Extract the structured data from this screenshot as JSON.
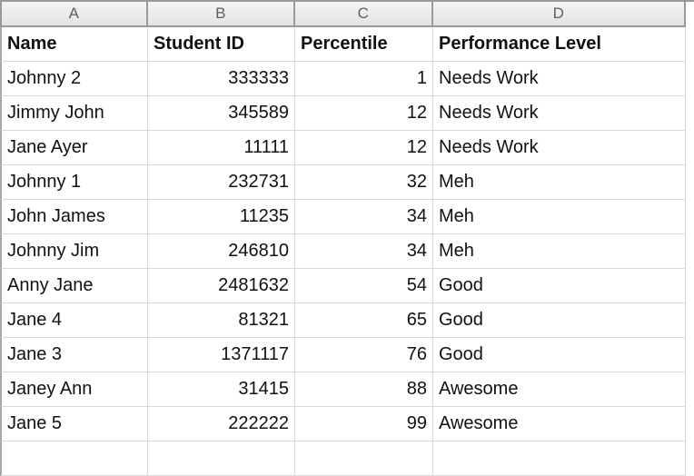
{
  "spreadsheet": {
    "column_letters": [
      "A",
      "B",
      "C",
      "D"
    ],
    "header_row": {
      "name": "Name",
      "student_id": "Student ID",
      "percentile": "Percentile",
      "performance_level": "Performance Level"
    },
    "rows": [
      {
        "name": "Johnny 2",
        "student_id": "333333",
        "percentile": "1",
        "performance_level": "Needs Work"
      },
      {
        "name": "Jimmy John",
        "student_id": "345589",
        "percentile": "12",
        "performance_level": "Needs Work"
      },
      {
        "name": "Jane Ayer",
        "student_id": "11111",
        "percentile": "12",
        "performance_level": "Needs Work"
      },
      {
        "name": "Johnny 1",
        "student_id": "232731",
        "percentile": "32",
        "performance_level": "Meh"
      },
      {
        "name": "John James",
        "student_id": "11235",
        "percentile": "34",
        "performance_level": "Meh"
      },
      {
        "name": "Johnny Jim",
        "student_id": "246810",
        "percentile": "34",
        "performance_level": "Meh"
      },
      {
        "name": "Anny Jane",
        "student_id": "2481632",
        "percentile": "54",
        "performance_level": "Good"
      },
      {
        "name": "Jane 4",
        "student_id": "81321",
        "percentile": "65",
        "performance_level": "Good"
      },
      {
        "name": "Jane 3",
        "student_id": "1371117",
        "percentile": "76",
        "performance_level": "Good"
      },
      {
        "name": "Janey Ann",
        "student_id": "31415",
        "percentile": "88",
        "performance_level": "Awesome"
      },
      {
        "name": "Jane 5",
        "student_id": "222222",
        "percentile": "99",
        "performance_level": "Awesome"
      },
      {
        "name": "",
        "student_id": "",
        "percentile": "",
        "performance_level": ""
      }
    ],
    "colors": {
      "grid_line": "#d8d8d8",
      "header_border": "#9a9a9a",
      "header_fill": "#ececec",
      "header_letter_text": "#606060",
      "cell_text": "#111111",
      "background": "#ffffff"
    }
  }
}
